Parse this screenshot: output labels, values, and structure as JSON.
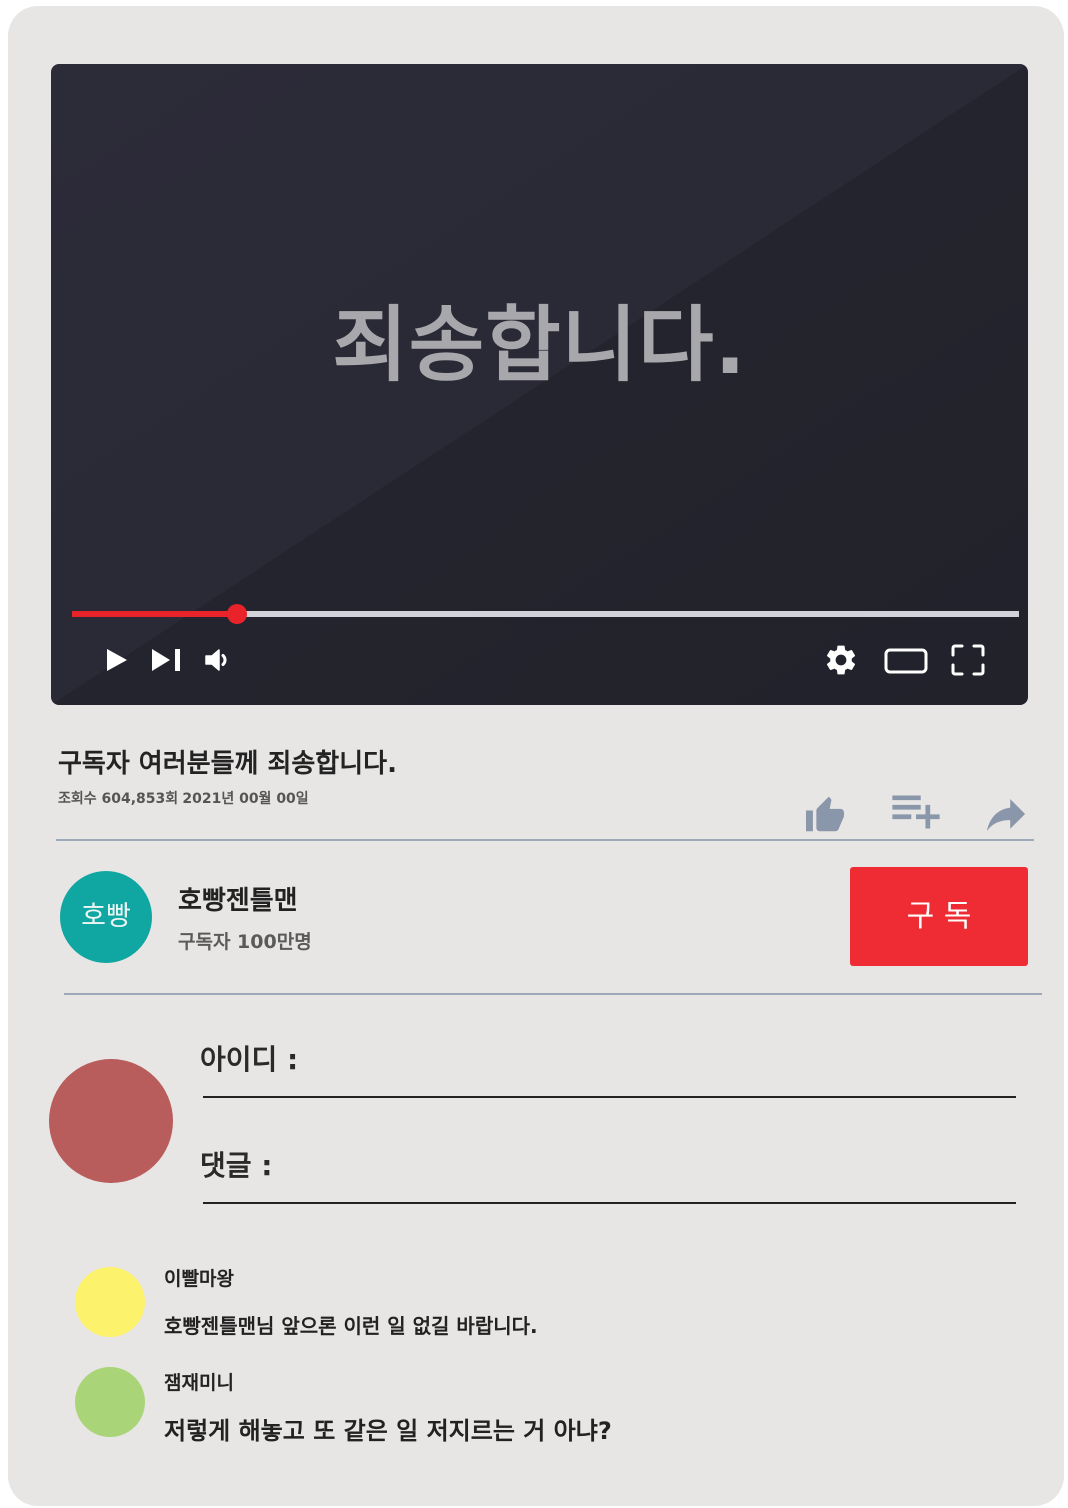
{
  "player": {
    "overlay_text": "죄송합니다.",
    "progress": 0.174,
    "progress_color": "#e8232a",
    "controls_left": [
      "play-icon",
      "skip-next-icon",
      "volume-icon"
    ],
    "controls_right": [
      "settings-gear-icon",
      "theater-mode-icon",
      "fullscreen-icon"
    ]
  },
  "video": {
    "title": "구독자 여러분들께 죄송합니다.",
    "views": "조회수 604,853회",
    "date": "2021년 00월 00일",
    "actions": [
      "thumbs-up-icon",
      "playlist-add-icon",
      "share-icon"
    ]
  },
  "channel": {
    "avatar_text": "호빵",
    "avatar_color": "#10a6a2",
    "name": "호빵젠틀맨",
    "subscribers": "구독자 100만명",
    "subscribe_label": "구 독",
    "subscribe_color": "#ef2b33"
  },
  "comment_form": {
    "avatar_color": "#b85c5c",
    "id_label": "아이디 :",
    "comment_label": "댓글 :"
  },
  "comments": [
    {
      "author": "이빨마왕",
      "text": "호빵젠틀맨님 앞으론 이런 일 없길 바랍니다.",
      "avatar_color": "#fdf26c"
    },
    {
      "author": "잼재미니",
      "text": "저렇게 해놓고 또 같은 일 저지르는 거 아냐?",
      "avatar_color": "#a9d478"
    }
  ]
}
